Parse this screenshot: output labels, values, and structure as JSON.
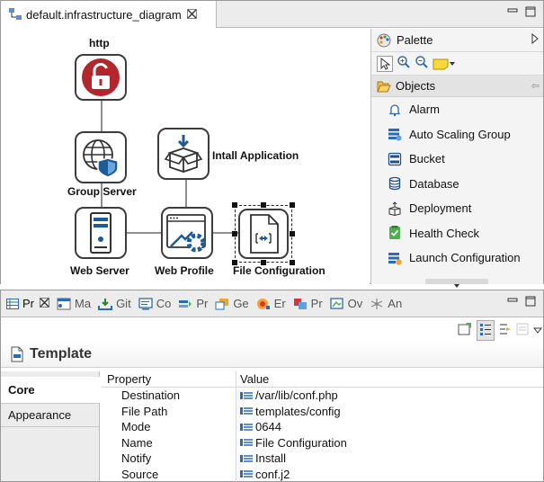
{
  "editor": {
    "tab_title": "default.infrastructure_diagram",
    "close_glyph": "✕",
    "minimize_glyph": "▭",
    "maximize_glyph": "□"
  },
  "diagram": {
    "nodes": [
      {
        "id": "http",
        "label": "http",
        "icon": "unlock-icon"
      },
      {
        "id": "group-server",
        "label": "Group Server",
        "icon": "globe-shield-icon"
      },
      {
        "id": "install-app",
        "label": "Intall Application",
        "icon": "box-download-icon"
      },
      {
        "id": "web-server",
        "label": "Web Server",
        "icon": "server-icon"
      },
      {
        "id": "web-profile",
        "label": "Web Profile",
        "icon": "browser-gear-icon"
      },
      {
        "id": "file-config",
        "label": "File Configuration",
        "icon": "config-file-icon"
      }
    ]
  },
  "palette": {
    "title": "Palette",
    "drawer_label": "Objects",
    "items": [
      {
        "label": "Alarm",
        "icon": "bell-icon"
      },
      {
        "label": "Auto Scaling Group",
        "icon": "autoscale-icon"
      },
      {
        "label": "Bucket",
        "icon": "bucket-icon"
      },
      {
        "label": "Database",
        "icon": "database-icon"
      },
      {
        "label": "Deployment",
        "icon": "deployment-icon"
      },
      {
        "label": "Health Check",
        "icon": "health-check-icon"
      },
      {
        "label": "Launch Configuration",
        "icon": "launch-config-icon"
      }
    ]
  },
  "views": {
    "tabs": [
      {
        "label": "Pr",
        "active": true
      },
      {
        "label": "Ma"
      },
      {
        "label": "Git"
      },
      {
        "label": "Co"
      },
      {
        "label": "Pr"
      },
      {
        "label": "Ge"
      },
      {
        "label": "Er"
      },
      {
        "label": "Pr"
      },
      {
        "label": "Ov"
      },
      {
        "label": "An"
      }
    ]
  },
  "properties": {
    "title": "Template",
    "side_tabs": [
      {
        "label": "Core",
        "active": true
      },
      {
        "label": "Appearance"
      }
    ],
    "col_property": "Property",
    "col_value": "Value",
    "rows": [
      {
        "name": "Destination",
        "value": "/var/lib/conf.php"
      },
      {
        "name": "File Path",
        "value": "templates/config"
      },
      {
        "name": "Mode",
        "value": "0644"
      },
      {
        "name": "Name",
        "value": "File Configuration"
      },
      {
        "name": "Notify",
        "value": "Install"
      },
      {
        "name": "Source",
        "value": "conf.j2"
      }
    ]
  }
}
